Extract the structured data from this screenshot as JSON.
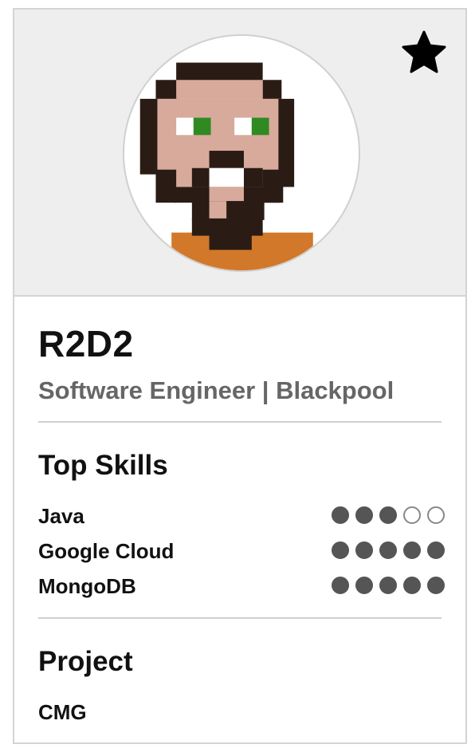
{
  "profile": {
    "name": "R2D2",
    "subtitle": "Software Engineer | Blackpool",
    "avatar_icon": "pixel-art-bearded-man-avatar",
    "favorite_icon": "star-icon",
    "favorited": true
  },
  "skills": {
    "title": "Top Skills",
    "items": [
      {
        "name": "Java",
        "rating": 3,
        "max": 5
      },
      {
        "name": "Google Cloud",
        "rating": 5,
        "max": 5
      },
      {
        "name": "MongoDB",
        "rating": 5,
        "max": 5
      }
    ]
  },
  "project": {
    "title": "Project",
    "value": "CMG"
  },
  "colors": {
    "header_bg": "#eeeeee",
    "dot_filled": "#555555",
    "subtitle": "#666666",
    "border": "#d4d4d4"
  }
}
